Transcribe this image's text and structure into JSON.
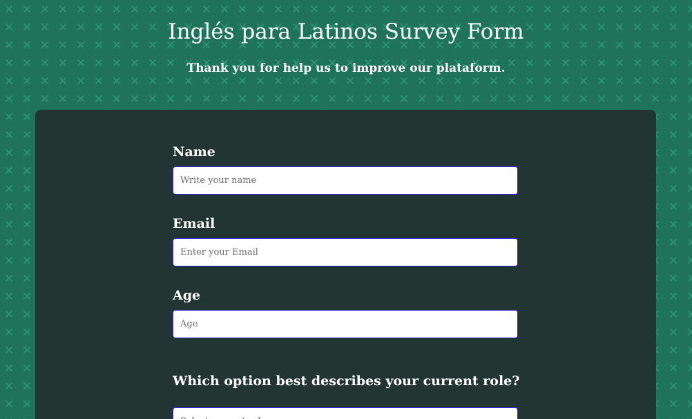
{
  "header": {
    "title": "Inglés para Latinos Survey Form",
    "description": "Thank you for help us to improve our plataform."
  },
  "form": {
    "name": {
      "label": "Name",
      "placeholder": "Write your name",
      "value": ""
    },
    "email": {
      "label": "Email",
      "placeholder": "Enter your Email",
      "value": ""
    },
    "age": {
      "label": "Age",
      "placeholder": "Age",
      "value": ""
    },
    "role": {
      "question": "Which option best describes your current role?",
      "selected": "Select current role"
    }
  },
  "colors": {
    "background": "#1f7359",
    "pattern": "#2e9670",
    "card": "#233532",
    "input_border": "#2a2ad6",
    "text": "#ffffff"
  },
  "icons": {
    "background_pattern": "x-mark-pattern"
  }
}
